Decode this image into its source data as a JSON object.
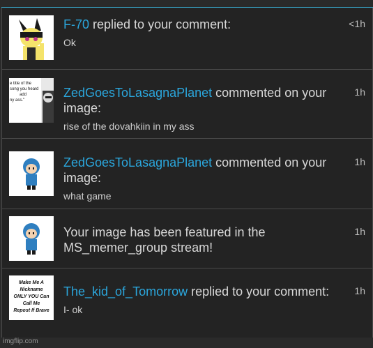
{
  "notifications": [
    {
      "username": "F-70",
      "action": " replied to your comment:",
      "message": "Ok",
      "time": "<1h",
      "thumb_icon": "wolf-character-thumbnail"
    },
    {
      "username": "ZedGoesToLasagnaPlanet",
      "action": " commented on your image:",
      "message": "rise of the dovahkiin in my ass",
      "time": "1h",
      "thumb_icon": "meme-text-thumbnail",
      "thumb_text": [
        "e title of the",
        "song you heard",
        "add",
        "ny ass.\""
      ]
    },
    {
      "username": "ZedGoesToLasagnaPlanet",
      "action": " commented on your image:",
      "message": "what game",
      "time": "1h",
      "thumb_icon": "blue-hooded-character-thumbnail"
    },
    {
      "username": "",
      "action": "Your image has been featured in the MS_memer_group stream!",
      "message": "",
      "time": "1h",
      "thumb_icon": "blue-hooded-character-thumbnail"
    },
    {
      "username": "The_kid_of_Tomorrow",
      "action": " replied to your comment:",
      "message": "I- ok",
      "time": "1h",
      "thumb_icon": "repost-sign-thumbnail",
      "thumb_text": [
        "Make Me A",
        "Nickname",
        "ONLY YOU Can",
        "Call Me",
        "Repost If Brave"
      ]
    }
  ],
  "footer": {
    "watermark": "imgflip.com"
  },
  "colors": {
    "username": "#2ba6dc",
    "accent": "#39a6c9",
    "background": "#232323"
  }
}
